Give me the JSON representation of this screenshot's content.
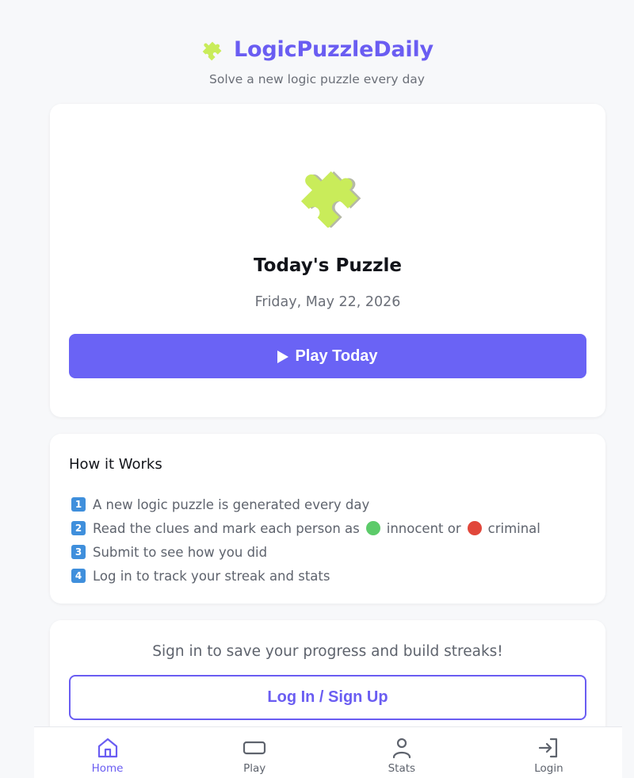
{
  "header": {
    "brand_icon": "puzzle-piece-icon",
    "title": "LogicPuzzleDaily",
    "tagline": "Solve a new logic puzzle every day"
  },
  "hero": {
    "icon": "puzzle-piece-icon",
    "title": "Today's Puzzle",
    "date": "Friday, May 22, 2026",
    "play_icon": "play-icon",
    "play_label": "Play Today"
  },
  "how_it_works": {
    "title": "How it Works",
    "steps": [
      {
        "number": "1",
        "text": "A new logic puzzle is generated every day"
      },
      {
        "number": "2",
        "text_before": "Read the clues and mark each person as",
        "innocent": "innocent or",
        "criminal": "criminal"
      },
      {
        "number": "3",
        "text": "Submit to see how you did"
      },
      {
        "number": "4",
        "text": "Log in to track your streak and stats"
      }
    ]
  },
  "login": {
    "prompt": "Sign in to save your progress and build streaks!",
    "button_label": "Log In / Sign Up"
  },
  "nav": {
    "items": [
      {
        "label": "Home",
        "icon": "home-icon",
        "active": true
      },
      {
        "label": "Play",
        "icon": "play-rect-icon",
        "active": false
      },
      {
        "label": "Stats",
        "icon": "user-icon",
        "active": false
      },
      {
        "label": "Login",
        "icon": "login-icon",
        "active": false
      }
    ]
  },
  "colors": {
    "accent": "#6a5df2",
    "play_button": "#6a63f5",
    "puzzle_green": "#c9ec5a",
    "innocent_dot": "#5ccb6a",
    "criminal_dot": "#e1473b",
    "step_badge": "#3f8fdc"
  }
}
